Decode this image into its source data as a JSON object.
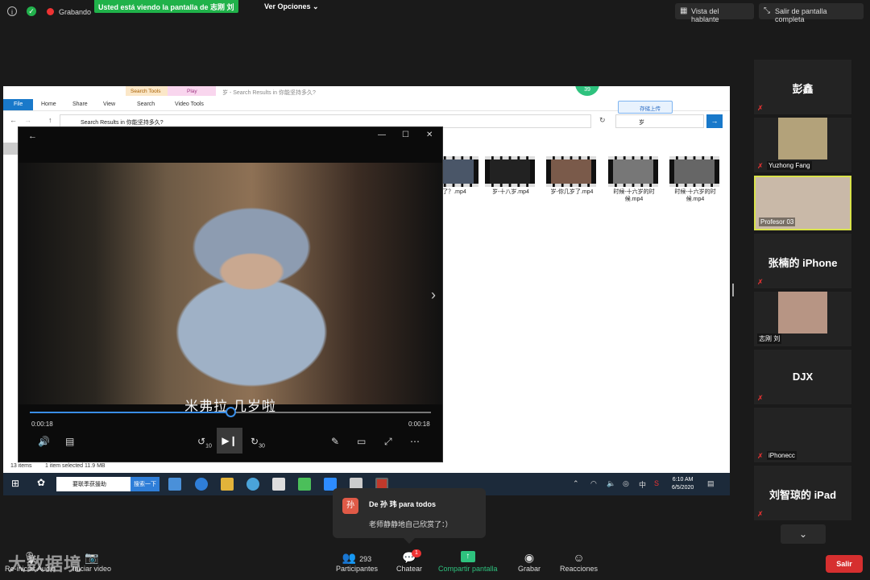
{
  "top_bar": {
    "recording_label": "Grabando",
    "share_banner": "Usted está viendo la pantalla de 志刚 刘",
    "view_options": "Ver Opciones",
    "speaker_view": "Vista del hablante",
    "exit_fullscreen": "Salir de pantalla completa"
  },
  "explorer": {
    "title": "岁 - Search Results in 你能坚持多久?",
    "tabs": [
      "File",
      "Home",
      "Share",
      "View",
      "Search",
      "Video Tools"
    ],
    "context_groups": [
      "Search Tools",
      "Play"
    ],
    "address": "Search Results in 你能坚持多久?",
    "search_value": "岁",
    "cloud_upload": "存储上传",
    "badge": "39",
    "status_items": "13 items",
    "status_selected": "1 item selected  11.9 MB",
    "files": [
      {
        "caption": "了？.mp4",
        "color": "#4a5668"
      },
      {
        "caption": "岁-十八岁.mp4",
        "color": "#222"
      },
      {
        "caption": "岁-你几岁了.mp4",
        "color": "#7a5a4a"
      },
      {
        "caption": "时候-十六岁的时候.mp4",
        "color": "#777"
      },
      {
        "caption": "时候-十六岁的时候.mp4",
        "color": "#666"
      }
    ]
  },
  "player": {
    "subtitle": "米弗拉 几岁啦",
    "time_current": "0:00:18",
    "time_total": "0:00:18",
    "progress": 0.5,
    "skip_back": "10",
    "skip_forward": "30"
  },
  "taskbar": {
    "search_placeholder": "要联季获援助",
    "search_button": "搜索一下",
    "time": "6:10 AM",
    "date": "6/5/2020",
    "ime": "中"
  },
  "participants_panel": [
    {
      "name": "彭鑫",
      "type": "name",
      "muted": true
    },
    {
      "name": "Yuzhong Fang",
      "type": "video",
      "muted": true,
      "photo": "#b3a27a"
    },
    {
      "name": "Profesor 03",
      "type": "video",
      "muted": false,
      "active": true,
      "photo": "#c9b9a8"
    },
    {
      "name": "张楠的 iPhone",
      "type": "name",
      "muted": true
    },
    {
      "name": "志刚 刘",
      "type": "video",
      "muted": false,
      "photo": "#b79584"
    },
    {
      "name": "DJX",
      "type": "name",
      "muted": true
    },
    {
      "name": "iPhonecc",
      "type": "label",
      "muted": true
    },
    {
      "name": "刘智琼的 iPad",
      "type": "name",
      "muted": true
    }
  ],
  "chat_popup": {
    "avatar_char": "孙",
    "from": "De 孙 玮 para todos",
    "message": "老师静静地自己欣赏了：）"
  },
  "controls": {
    "audio": "Re-iniciar Audio",
    "video": "Iniciar video",
    "participants_count": "293",
    "participants": "Participantes",
    "chat": "Chatear",
    "chat_badge": "1",
    "share": "Compartir pantalla",
    "record": "Grabar",
    "reactions": "Reacciones",
    "leave": "Salir"
  },
  "watermark": "大数据境",
  "colors": {
    "accent_green": "#2ec27e",
    "leave_red": "#d62f2f",
    "active_border": "#d9e34b"
  }
}
